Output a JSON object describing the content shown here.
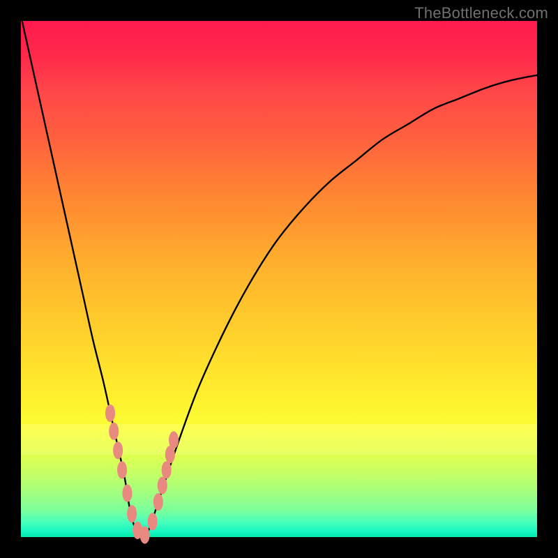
{
  "watermark": "TheBottleneck.com",
  "colors": {
    "frame": "#000000",
    "curve": "#000000",
    "marker": "#e98a80",
    "top_grad": "#ff1a4d",
    "mid_grad": "#ffdf2c",
    "bot_grad": "#00e8a8"
  },
  "chart_data": {
    "type": "line",
    "title": "",
    "xlabel": "",
    "ylabel": "",
    "xlim": [
      0,
      100
    ],
    "ylim": [
      0,
      100
    ],
    "series": [
      {
        "name": "bottleneck-curve",
        "x": [
          0,
          2,
          4,
          6,
          8,
          10,
          12,
          14,
          16,
          18,
          20,
          21,
          22,
          23,
          24,
          25,
          27,
          30,
          34,
          38,
          42,
          46,
          50,
          55,
          60,
          65,
          70,
          75,
          80,
          85,
          90,
          95,
          100
        ],
        "y": [
          101,
          92,
          83,
          74,
          65,
          56,
          47,
          38,
          30,
          21,
          12,
          6,
          2,
          0,
          0,
          2,
          8,
          17,
          28,
          37,
          45,
          52,
          58,
          64,
          69,
          73,
          77,
          80,
          83,
          85,
          87,
          88.5,
          89.5
        ]
      }
    ],
    "markers": {
      "name": "highlight-points",
      "x": [
        17.3,
        18.0,
        18.8,
        19.6,
        20.6,
        21.5,
        22.6,
        24.0,
        25.5,
        26.6,
        27.4,
        28.2,
        28.9,
        29.6
      ],
      "y": [
        24.0,
        20.5,
        16.8,
        13.0,
        8.5,
        4.5,
        1.3,
        0.4,
        3.0,
        6.8,
        10.0,
        13.0,
        16.0,
        18.8
      ],
      "rx": 0.95,
      "ry": 1.7
    }
  }
}
